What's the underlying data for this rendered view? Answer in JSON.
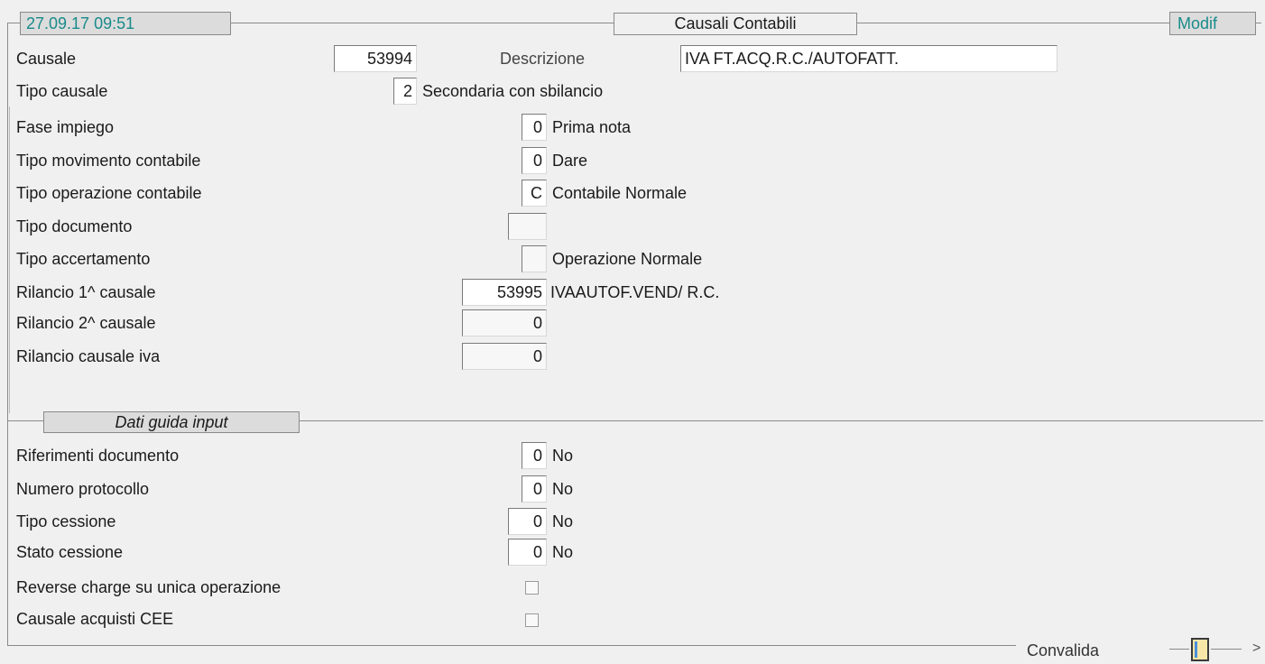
{
  "header": {
    "datetime": "27.09.17 09:51",
    "title": "Causali Contabili",
    "mode": "Modif"
  },
  "main": {
    "causale": {
      "label": "Causale",
      "value": "53994"
    },
    "descrizione": {
      "label": "Descrizione",
      "value": "IVA FT.ACQ.R.C./AUTOFATT."
    },
    "tipo_causale": {
      "label": "Tipo causale",
      "value": "2",
      "desc": "Secondaria con sbilancio"
    },
    "fase_impiego": {
      "label": "Fase impiego",
      "value": "0",
      "desc": "Prima nota"
    },
    "tipo_movimento": {
      "label": "Tipo movimento contabile",
      "value": "0",
      "desc": "Dare"
    },
    "tipo_operazione": {
      "label": "Tipo operazione contabile",
      "value": "C",
      "desc": "Contabile Normale"
    },
    "tipo_documento": {
      "label": "Tipo documento",
      "value": ""
    },
    "tipo_accertamento": {
      "label": "Tipo accertamento",
      "value": "",
      "desc": "Operazione Normale"
    },
    "rilancio1": {
      "label": "Rilancio 1^ causale",
      "value": "53995",
      "desc": "IVAAUTOF.VEND/ R.C."
    },
    "rilancio2": {
      "label": "Rilancio 2^ causale",
      "value": "0"
    },
    "rilancio_iva": {
      "label": "Rilancio causale iva",
      "value": "0"
    }
  },
  "section2": {
    "title": "Dati guida input",
    "riferimenti": {
      "label": "Riferimenti documento",
      "value": "0",
      "desc": "No"
    },
    "protocollo": {
      "label": "Numero protocollo",
      "value": "0",
      "desc": "No"
    },
    "tipo_cessione": {
      "label": "Tipo cessione",
      "value": "0",
      "desc": "No"
    },
    "stato_cessione": {
      "label": "Stato cessione",
      "value": "0",
      "desc": "No"
    },
    "reverse_charge": {
      "label": "Reverse charge su unica operazione",
      "checked": false
    },
    "acquisti_cee": {
      "label": "Causale acquisti CEE",
      "checked": false
    }
  },
  "footer": {
    "convalida": "Convalida",
    "arrow": ">"
  },
  "colors": {
    "accent_text": "#1a8a8a",
    "background": "#f0f0f0"
  }
}
